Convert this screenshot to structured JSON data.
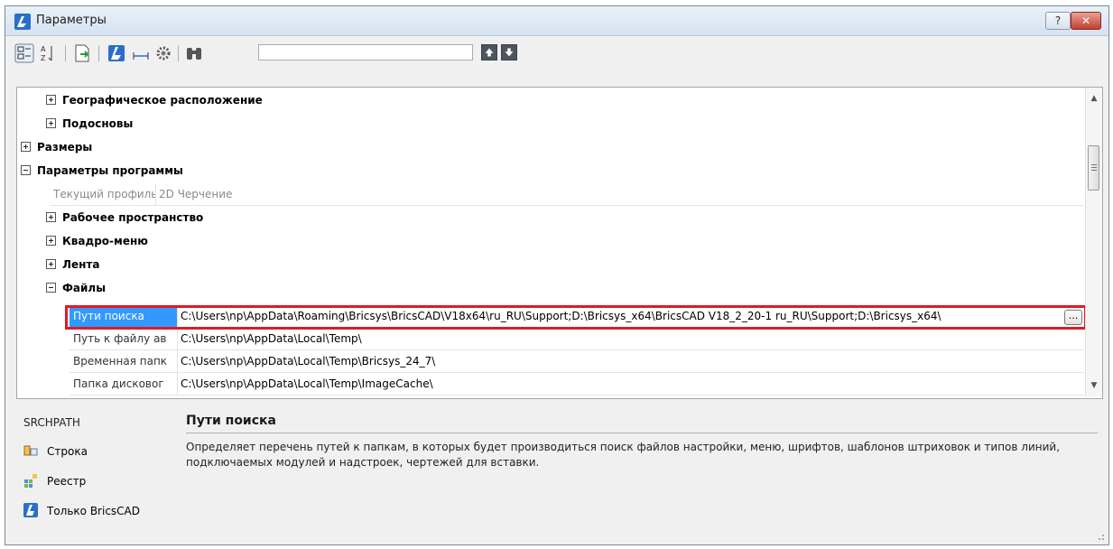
{
  "window": {
    "title": "Параметры",
    "help_label": "?",
    "close_label": "✕"
  },
  "toolbar": {
    "search": {
      "value": "",
      "placeholder": ""
    },
    "buttons": [
      "categorized-icon",
      "alphabetic-icon",
      "export-icon",
      "bricscad-icon",
      "width-icon",
      "settings-icon",
      "find-icon",
      "up-arrow-icon",
      "down-arrow-icon"
    ]
  },
  "tree": {
    "nodes": [
      {
        "label": "Географическое расположение",
        "level": 1,
        "state": "collapsed"
      },
      {
        "label": "Подосновы",
        "level": 1,
        "state": "collapsed"
      },
      {
        "label": "Размеры",
        "level": 0,
        "state": "collapsed"
      },
      {
        "label": "Параметры программы",
        "level": 0,
        "state": "expanded"
      },
      {
        "label": "Рабочее пространство",
        "level": 1,
        "state": "collapsed"
      },
      {
        "label": "Квадро-меню",
        "level": 1,
        "state": "collapsed"
      },
      {
        "label": "Лента",
        "level": 1,
        "state": "collapsed"
      },
      {
        "label": "Файлы",
        "level": 1,
        "state": "expanded"
      }
    ],
    "profile": {
      "name": "Текущий профиль",
      "value": "2D Черчение"
    },
    "files": [
      {
        "name": "Пути поиска",
        "value": "C:\\Users\\np\\AppData\\Roaming\\Bricsys\\BricsCAD\\V18x64\\ru_RU\\Support;D:\\Bricsys_x64\\BricsCAD V18_2_20-1 ru_RU\\Support;D:\\Bricsys_x64\\",
        "selected": true
      },
      {
        "name": "Путь к файлу ав",
        "value": "C:\\Users\\np\\AppData\\Local\\Temp\\"
      },
      {
        "name": "Временная папк",
        "value": "C:\\Users\\np\\AppData\\Local\\Temp\\Bricsys_24_7\\"
      },
      {
        "name": "Папка дисковог",
        "value": "C:\\Users\\np\\AppData\\Local\\Temp\\ImageCache\\"
      }
    ],
    "browse_label": "..."
  },
  "info": {
    "variable": "SRCHPATH",
    "legend": [
      {
        "icon": "string-icon",
        "label": "Строка"
      },
      {
        "icon": "registry-icon",
        "label": "Реестр"
      },
      {
        "icon": "bricscad-only-icon",
        "label": "Только BricsCAD"
      }
    ],
    "title": "Пути поиска",
    "description": "Определяет перечень путей к папкам, в которых будет производиться поиск файлов настройки, меню, шрифтов, шаблонов штриховок и типов линий, подключаемых модулей и надстроек, чертежей для вставки."
  },
  "colors": {
    "selection": "#3399ff",
    "highlight": "#e01b24",
    "brand": "#2a6fc9"
  }
}
